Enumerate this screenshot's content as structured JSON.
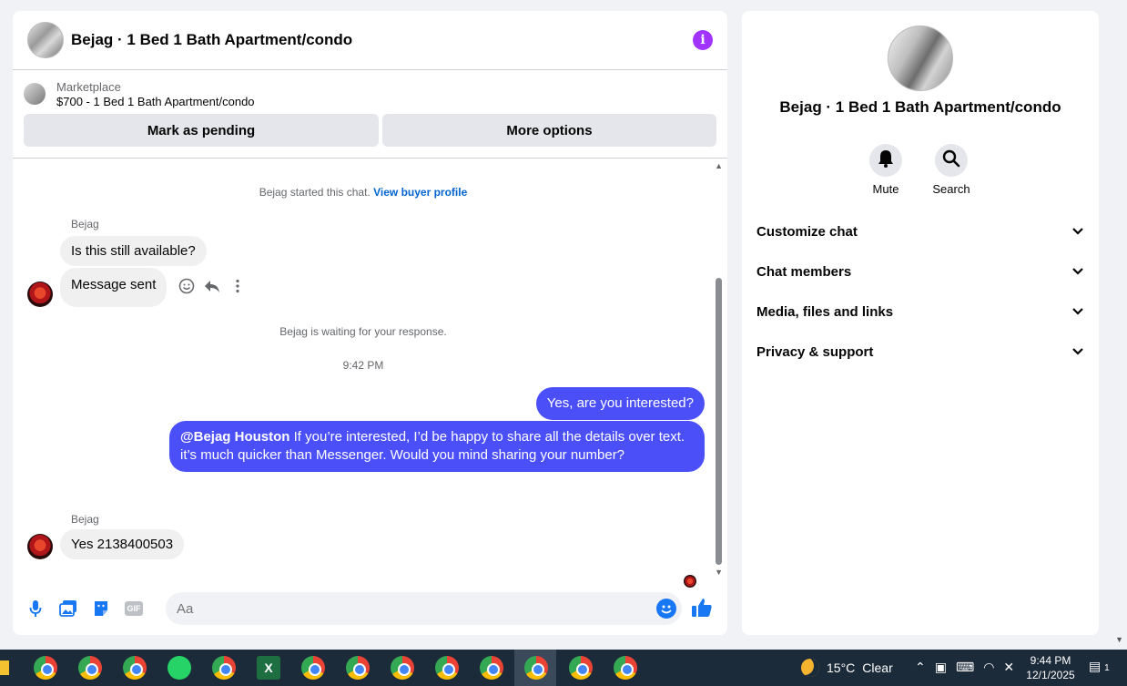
{
  "header": {
    "title": "Bejag · 1 Bed 1 Bath Apartment/condo",
    "info_icon": "i"
  },
  "listing": {
    "label": "Marketplace",
    "name": "$700 - 1 Bed 1 Bath Apartment/condo",
    "pending_button": "Mark as pending",
    "more_button": "More options"
  },
  "messages": {
    "started_text": "Bejag started this chat.",
    "buyer_profile_link": "View buyer profile",
    "sender_1": "Bejag",
    "incoming_1": "Is this still available?",
    "incoming_2": "Message sent",
    "waiting_text": "Bejag is waiting for your response.",
    "timestamp": "9:42 PM",
    "outgoing_1": "Yes, are you interested?",
    "outgoing_2_mention": "@Bejag Houston",
    "outgoing_2_text": " If you’re interested, I’d be happy to share all the details over text. it’s much quicker than Messenger. Would you mind sharing your number?",
    "sender_2": "Bejag",
    "incoming_3": "Yes 2138400503"
  },
  "composer": {
    "placeholder": "Aa",
    "gif_label": "GIF"
  },
  "info_panel": {
    "title": "Bejag · 1 Bed 1 Bath Apartment/condo",
    "mute_label": "Mute",
    "search_label": "Search",
    "sections": [
      "Customize chat",
      "Chat members",
      "Media, files and links",
      "Privacy & support"
    ]
  },
  "taskbar": {
    "excel_label": "X",
    "temperature": "15°C",
    "weather": "Clear",
    "time": "9:44 PM",
    "date": "12/1/2025",
    "notification_count": "1"
  },
  "colors": {
    "accent": "#4b4ff8",
    "info": "#a033ff",
    "link": "#0064d1",
    "icon_blue": "#1877f2"
  }
}
